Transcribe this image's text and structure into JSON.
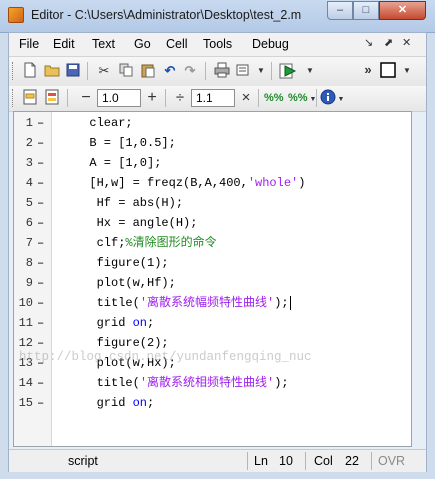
{
  "window": {
    "title": "Editor - C:\\Users\\Administrator\\Desktop\\test_2.m",
    "min_glyph": "–",
    "max_glyph": "□",
    "close_glyph": "✕"
  },
  "menu": {
    "items": [
      "File",
      "Edit",
      "Text",
      "Go",
      "Cell",
      "Tools",
      "Debug"
    ],
    "dock_glyph": "↘",
    "undock_glyph": "⬈",
    "close_glyph": "✕"
  },
  "cell_toolbar": {
    "minus_glyph": "−",
    "value1": "1.0",
    "plus_glyph": "+",
    "divide_glyph": "÷",
    "value2": "1.1",
    "times_glyph": "×"
  },
  "editor": {
    "lines": [
      {
        "n": "1",
        "bp": "–",
        "parts": [
          {
            "t": "  clear;",
            "c": ""
          }
        ]
      },
      {
        "n": "2",
        "bp": "–",
        "parts": [
          {
            "t": "  B = [1,0.5];",
            "c": ""
          }
        ]
      },
      {
        "n": "3",
        "bp": "–",
        "parts": [
          {
            "t": "  A = [1,0];",
            "c": ""
          }
        ]
      },
      {
        "n": "4",
        "bp": "–",
        "parts": [
          {
            "t": "  [H,w] = freqz(B,A,400,",
            "c": ""
          },
          {
            "t": "'whole'",
            "c": "str"
          },
          {
            "t": ")",
            "c": ""
          }
        ]
      },
      {
        "n": "5",
        "bp": "–",
        "parts": [
          {
            "t": "   Hf = abs(H);",
            "c": ""
          }
        ]
      },
      {
        "n": "6",
        "bp": "–",
        "parts": [
          {
            "t": "   Hx = angle(H);",
            "c": ""
          }
        ]
      },
      {
        "n": "7",
        "bp": "–",
        "parts": [
          {
            "t": "   clf;",
            "c": ""
          },
          {
            "t": "%清除图形的命令",
            "c": "cm"
          }
        ]
      },
      {
        "n": "8",
        "bp": "–",
        "parts": [
          {
            "t": "   figure(1);",
            "c": ""
          }
        ]
      },
      {
        "n": "9",
        "bp": "–",
        "parts": [
          {
            "t": "   plot(w,Hf);",
            "c": ""
          }
        ]
      },
      {
        "n": "10",
        "bp": "–",
        "parts": [
          {
            "t": "   title(",
            "c": ""
          },
          {
            "t": "'离散系统幅频特性曲线'",
            "c": "str"
          },
          {
            "t": ");",
            "c": ""
          }
        ]
      },
      {
        "n": "11",
        "bp": "–",
        "parts": [
          {
            "t": "   grid ",
            "c": ""
          },
          {
            "t": "on",
            "c": "kw"
          },
          {
            "t": ";",
            "c": ""
          }
        ]
      },
      {
        "n": "12",
        "bp": "–",
        "parts": [
          {
            "t": "   figure(2);",
            "c": ""
          }
        ]
      },
      {
        "n": "13",
        "bp": "–",
        "parts": [
          {
            "t": "   plot(w,Hx);",
            "c": ""
          }
        ]
      },
      {
        "n": "14",
        "bp": "–",
        "parts": [
          {
            "t": "   title(",
            "c": ""
          },
          {
            "t": "'离散系统相频特性曲线'",
            "c": "str"
          },
          {
            "t": ");",
            "c": ""
          }
        ]
      },
      {
        "n": "15",
        "bp": "–",
        "parts": [
          {
            "t": "   grid ",
            "c": ""
          },
          {
            "t": "on",
            "c": "kw"
          },
          {
            "t": ";",
            "c": ""
          }
        ]
      }
    ],
    "watermark": "http://blog.csdn.net/yundanfengqing_nuc"
  },
  "status": {
    "type": "script",
    "ln_label": "Ln",
    "ln_value": "10",
    "col_label": "Col",
    "col_value": "22",
    "ovr": "OVR"
  },
  "colors": {
    "keyword": "#0000ff",
    "string": "#a020f0",
    "comment": "#228b22"
  }
}
